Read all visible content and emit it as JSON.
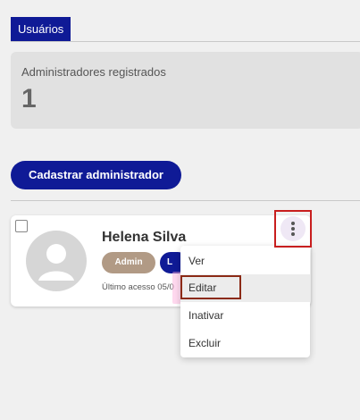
{
  "tabs": [
    {
      "label": "Usuários",
      "active": true
    }
  ],
  "stats": {
    "label": "Administradores registrados",
    "value": "1"
  },
  "actions": {
    "register_admin_label": "Cadastrar administrador"
  },
  "user": {
    "name": "Helena Silva",
    "role_badge": "Admin",
    "status_badge": "L",
    "last_access": "Último acesso 05/0"
  },
  "context_menu": {
    "items": [
      "Ver",
      "Editar",
      "Inativar",
      "Excluir"
    ],
    "highlighted": "Editar"
  },
  "colors": {
    "primary": "#0f1a96",
    "role_badge": "#b19a85",
    "highlight_outline": "#c81e1e",
    "edit_outline": "#8b2a16"
  },
  "icons": {
    "more": "more-vertical-icon",
    "avatar": "default-user-avatar"
  }
}
